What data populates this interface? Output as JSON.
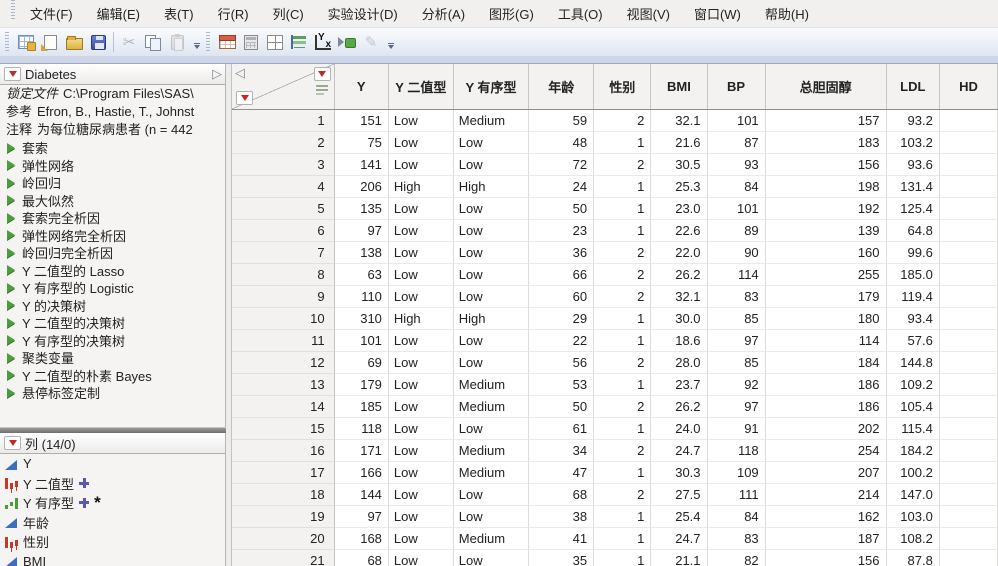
{
  "menu": {
    "items": [
      {
        "label": "文件(F)"
      },
      {
        "label": "编辑(E)"
      },
      {
        "label": "表(T)"
      },
      {
        "label": "行(R)"
      },
      {
        "label": "列(C)"
      },
      {
        "label": "实验设计(D)"
      },
      {
        "label": "分析(A)"
      },
      {
        "label": "图形(G)"
      },
      {
        "label": "工具(O)"
      },
      {
        "label": "视图(V)"
      },
      {
        "label": "窗口(W)"
      },
      {
        "label": "帮助(H)"
      }
    ]
  },
  "toolbar": {
    "group1": [
      {
        "name": "new-data-table-icon",
        "cls": "ic-newtable",
        "disabled": false,
        "glyph": ""
      },
      {
        "name": "new-journal-icon",
        "cls": "ic-journal",
        "disabled": false,
        "glyph": ""
      },
      {
        "name": "open-icon",
        "cls": "ic-folder",
        "disabled": false,
        "glyph": ""
      },
      {
        "name": "save-icon",
        "cls": "ic-save",
        "disabled": false,
        "glyph": ""
      },
      {
        "name": "separator",
        "cls": "sep",
        "disabled": false,
        "glyph": ""
      },
      {
        "name": "cut-icon",
        "cls": "ic-glyph",
        "disabled": true,
        "glyph": "✂"
      },
      {
        "name": "copy-icon",
        "cls": "ic-copy",
        "disabled": false,
        "glyph": ""
      },
      {
        "name": "paste-icon",
        "cls": "ic-paste",
        "disabled": true,
        "glyph": ""
      }
    ],
    "group2": [
      {
        "name": "data-table-icon",
        "cls": "ic-redtable",
        "disabled": false,
        "glyph": ""
      },
      {
        "name": "distribution-icon",
        "cls": "ic-calc",
        "disabled": false,
        "glyph": ""
      },
      {
        "name": "graph-builder-icon",
        "cls": "ic-panes",
        "disabled": false,
        "glyph": ""
      },
      {
        "name": "chart-icon",
        "cls": "ic-hbars",
        "disabled": false,
        "glyph": ""
      },
      {
        "name": "fit-y-by-x-icon",
        "cls": "ic-yx",
        "disabled": false,
        "glyph": ""
      },
      {
        "name": "join-icon",
        "cls": "ic-join",
        "disabled": false,
        "glyph": ""
      },
      {
        "name": "edit-icon",
        "cls": "ic-pencil",
        "disabled": true,
        "glyph": "✎"
      }
    ]
  },
  "table_panel": {
    "title": "Diabetes",
    "properties": [
      {
        "label": "锁定文件",
        "value": "C:\\Program Files\\SAS\\",
        "italic": true
      },
      {
        "label": "参考",
        "value": "Efron, B., Hastie, T., Johnst",
        "italic": false
      },
      {
        "label": "注释",
        "value": "为每位糖尿病患者 (n = 442",
        "italic": false
      }
    ],
    "scripts": [
      "套索",
      "弹性网络",
      "岭回归",
      "最大似然",
      "套索完全析因",
      "弹性网络完全析因",
      "岭回归完全析因",
      "Y 二值型的 Lasso",
      "Y 有序型的 Logistic",
      "Y 的决策树",
      "Y 二值型的决策树",
      "Y 有序型的决策树",
      "聚类变量",
      "Y 二值型的朴素 Bayes",
      "悬停标签定制"
    ]
  },
  "columns_panel": {
    "title": "列 (14/0)",
    "items": [
      {
        "name": "Y",
        "type": "continuous",
        "plus": false,
        "asterisk": false
      },
      {
        "name": "Y 二值型",
        "type": "nominal",
        "plus": true,
        "asterisk": false
      },
      {
        "name": "Y 有序型",
        "type": "ordinal",
        "plus": true,
        "asterisk": true
      },
      {
        "name": "年龄",
        "type": "continuous",
        "plus": false,
        "asterisk": false
      },
      {
        "name": "性别",
        "type": "nominal",
        "plus": false,
        "asterisk": false
      },
      {
        "name": "BMI",
        "type": "continuous",
        "plus": false,
        "asterisk": false
      }
    ]
  },
  "grid": {
    "columns": [
      {
        "label": "Y",
        "align": "right"
      },
      {
        "label": "Y 二值型",
        "align": "left"
      },
      {
        "label": "Y 有序型",
        "align": "left"
      },
      {
        "label": "年龄",
        "align": "right"
      },
      {
        "label": "性别",
        "align": "right"
      },
      {
        "label": "BMI",
        "align": "right"
      },
      {
        "label": "BP",
        "align": "right"
      },
      {
        "label": "总胆固醇",
        "align": "right"
      },
      {
        "label": "LDL",
        "align": "right"
      },
      {
        "label": "HD",
        "align": "right"
      }
    ],
    "rows": [
      {
        "n": "1",
        "cells": [
          "151",
          "Low",
          "Medium",
          "59",
          "2",
          "32.1",
          "101",
          "157",
          "93.2",
          ""
        ]
      },
      {
        "n": "2",
        "cells": [
          "75",
          "Low",
          "Low",
          "48",
          "1",
          "21.6",
          "87",
          "183",
          "103.2",
          ""
        ]
      },
      {
        "n": "3",
        "cells": [
          "141",
          "Low",
          "Low",
          "72",
          "2",
          "30.5",
          "93",
          "156",
          "93.6",
          ""
        ]
      },
      {
        "n": "4",
        "cells": [
          "206",
          "High",
          "High",
          "24",
          "1",
          "25.3",
          "84",
          "198",
          "131.4",
          ""
        ]
      },
      {
        "n": "5",
        "cells": [
          "135",
          "Low",
          "Low",
          "50",
          "1",
          "23.0",
          "101",
          "192",
          "125.4",
          ""
        ]
      },
      {
        "n": "6",
        "cells": [
          "97",
          "Low",
          "Low",
          "23",
          "1",
          "22.6",
          "89",
          "139",
          "64.8",
          ""
        ]
      },
      {
        "n": "7",
        "cells": [
          "138",
          "Low",
          "Low",
          "36",
          "2",
          "22.0",
          "90",
          "160",
          "99.6",
          ""
        ]
      },
      {
        "n": "8",
        "cells": [
          "63",
          "Low",
          "Low",
          "66",
          "2",
          "26.2",
          "114",
          "255",
          "185.0",
          ""
        ]
      },
      {
        "n": "9",
        "cells": [
          "110",
          "Low",
          "Low",
          "60",
          "2",
          "32.1",
          "83",
          "179",
          "119.4",
          ""
        ]
      },
      {
        "n": "10",
        "cells": [
          "310",
          "High",
          "High",
          "29",
          "1",
          "30.0",
          "85",
          "180",
          "93.4",
          ""
        ]
      },
      {
        "n": "11",
        "cells": [
          "101",
          "Low",
          "Low",
          "22",
          "1",
          "18.6",
          "97",
          "114",
          "57.6",
          ""
        ]
      },
      {
        "n": "12",
        "cells": [
          "69",
          "Low",
          "Low",
          "56",
          "2",
          "28.0",
          "85",
          "184",
          "144.8",
          ""
        ]
      },
      {
        "n": "13",
        "cells": [
          "179",
          "Low",
          "Medium",
          "53",
          "1",
          "23.7",
          "92",
          "186",
          "109.2",
          ""
        ]
      },
      {
        "n": "14",
        "cells": [
          "185",
          "Low",
          "Medium",
          "50",
          "2",
          "26.2",
          "97",
          "186",
          "105.4",
          ""
        ]
      },
      {
        "n": "15",
        "cells": [
          "118",
          "Low",
          "Low",
          "61",
          "1",
          "24.0",
          "91",
          "202",
          "115.4",
          ""
        ]
      },
      {
        "n": "16",
        "cells": [
          "171",
          "Low",
          "Medium",
          "34",
          "2",
          "24.7",
          "118",
          "254",
          "184.2",
          ""
        ]
      },
      {
        "n": "17",
        "cells": [
          "166",
          "Low",
          "Medium",
          "47",
          "1",
          "30.3",
          "109",
          "207",
          "100.2",
          ""
        ]
      },
      {
        "n": "18",
        "cells": [
          "144",
          "Low",
          "Low",
          "68",
          "2",
          "27.5",
          "111",
          "214",
          "147.0",
          ""
        ]
      },
      {
        "n": "19",
        "cells": [
          "97",
          "Low",
          "Low",
          "38",
          "1",
          "25.4",
          "84",
          "162",
          "103.0",
          ""
        ]
      },
      {
        "n": "20",
        "cells": [
          "168",
          "Low",
          "Medium",
          "41",
          "1",
          "24.7",
          "83",
          "187",
          "108.2",
          ""
        ]
      },
      {
        "n": "21",
        "cells": [
          "68",
          "Low",
          "Low",
          "35",
          "1",
          "21.1",
          "82",
          "156",
          "87.8",
          ""
        ]
      }
    ]
  },
  "colors": {
    "accent_red": "#c22a22",
    "script_green": "#4a9e3c",
    "continuous_blue": "#3a6ec0",
    "nominal_red": "#c23a2a",
    "ordinal_green": "#4a9e3c",
    "band_blue": "#cdd5e7"
  }
}
